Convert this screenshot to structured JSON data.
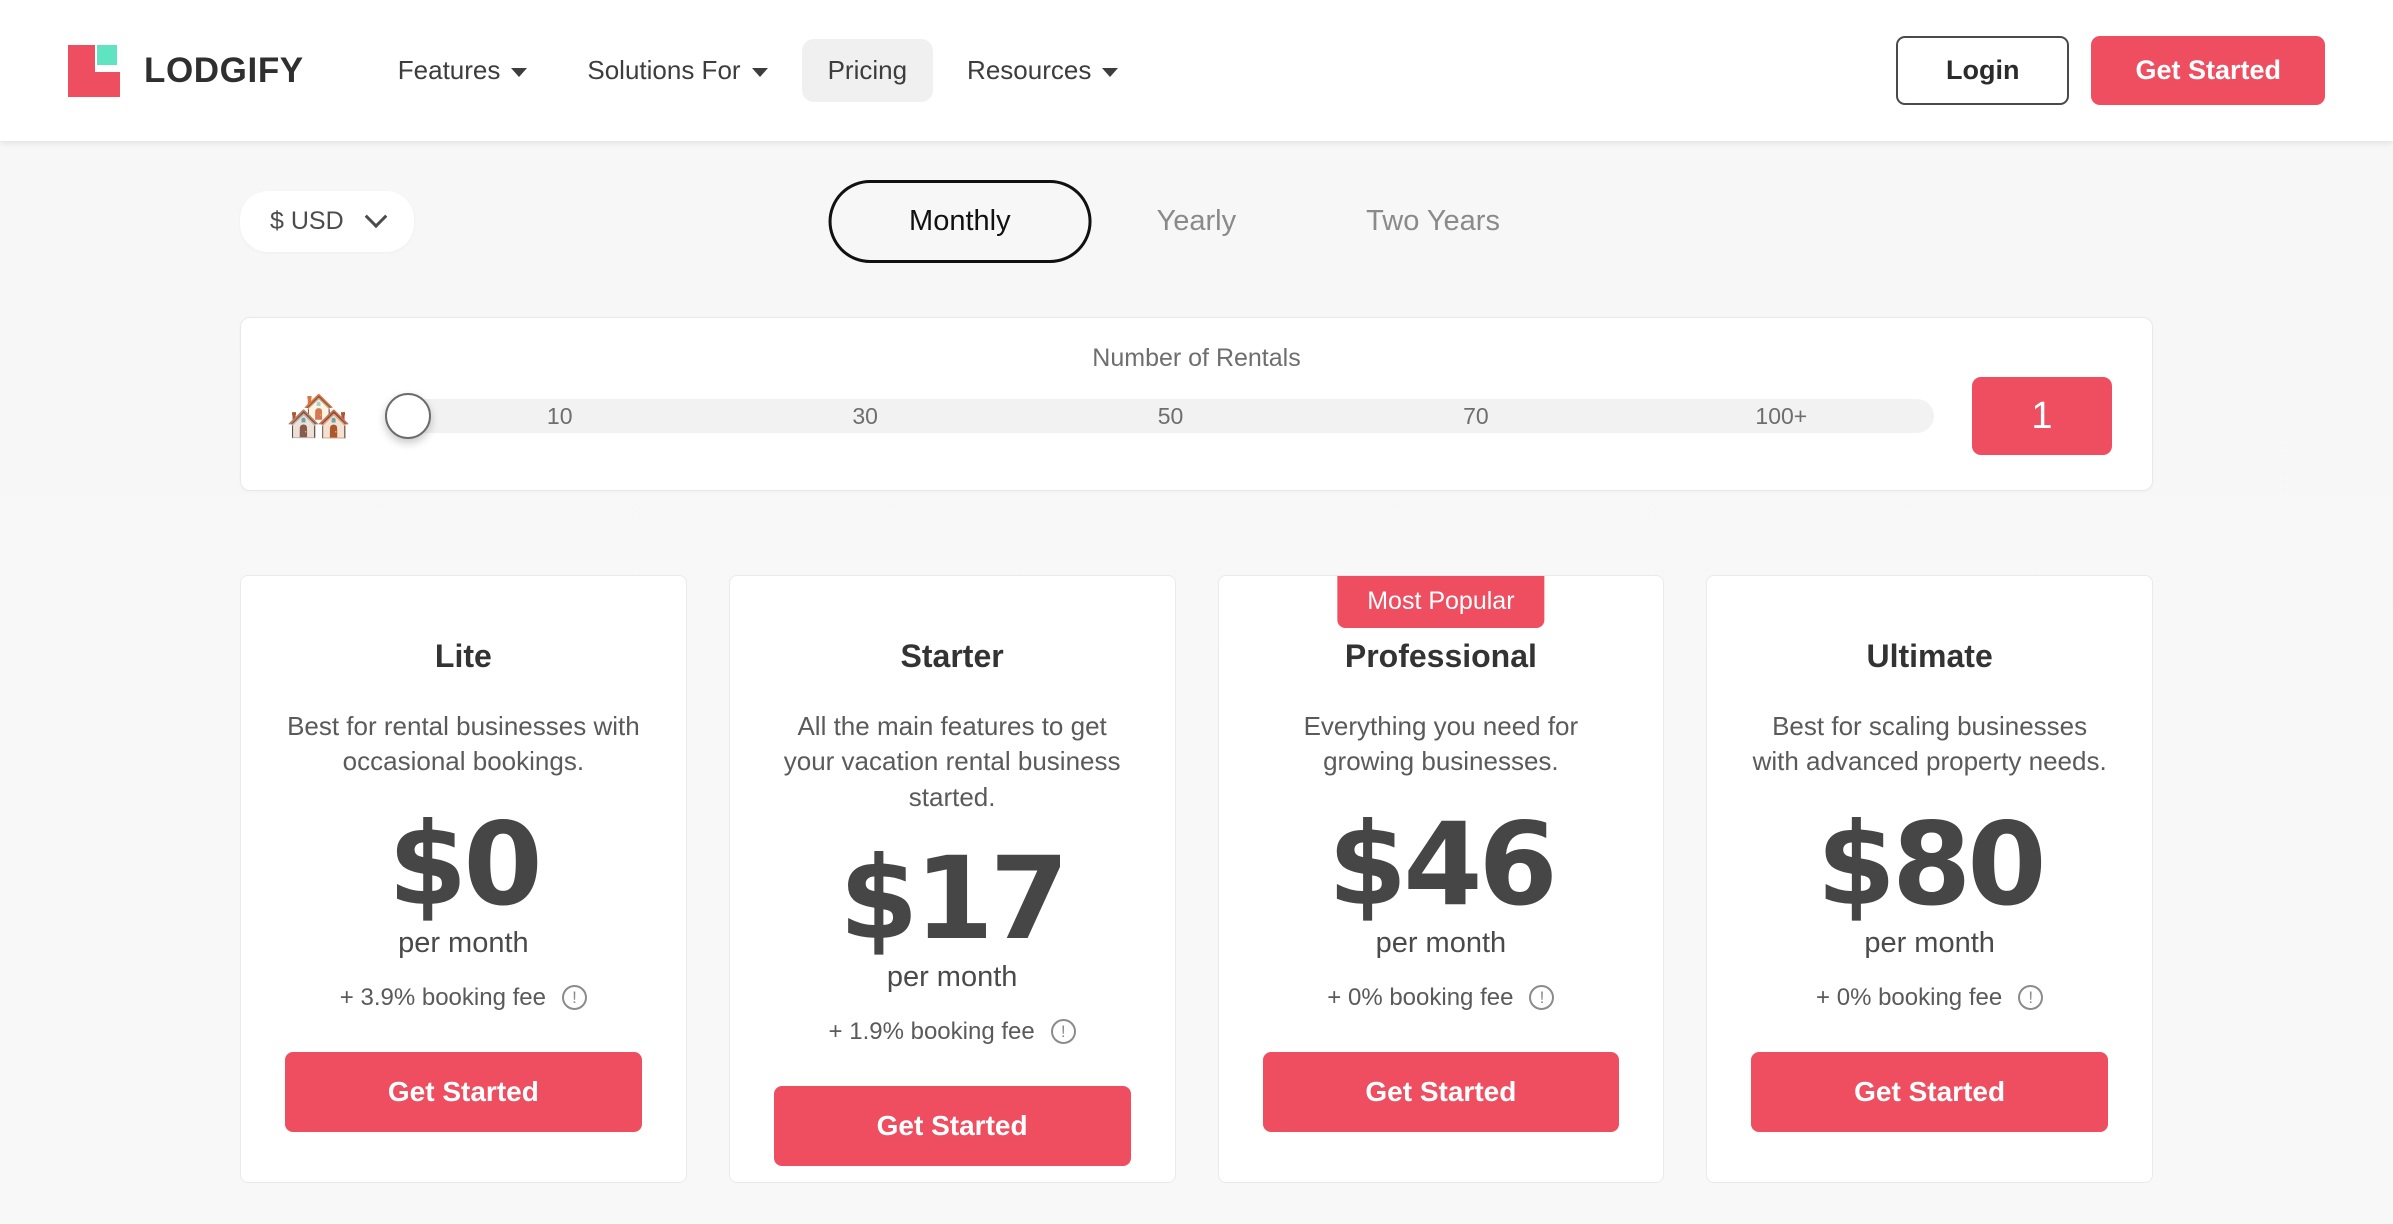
{
  "brand": {
    "name": "LODGIFY",
    "logo_primary_color": "#ee4e5f",
    "logo_accent_color": "#5fe3c0"
  },
  "header": {
    "nav": [
      {
        "label": "Features",
        "has_caret": true,
        "active": false
      },
      {
        "label": "Solutions For",
        "has_caret": true,
        "active": false
      },
      {
        "label": "Pricing",
        "has_caret": false,
        "active": true
      },
      {
        "label": "Resources",
        "has_caret": true,
        "active": false
      }
    ],
    "login_label": "Login",
    "get_started_label": "Get Started"
  },
  "controls": {
    "currency": {
      "value": "$ USD",
      "icon": "chevron-down-icon"
    },
    "billing_options": [
      {
        "label": "Monthly",
        "selected": true
      },
      {
        "label": "Yearly",
        "selected": false
      },
      {
        "label": "Two Years",
        "selected": false
      }
    ]
  },
  "rentals": {
    "label": "Number of Rentals",
    "emoji": "🏘️",
    "emoji_name": "houses-emoji",
    "ticks": [
      "10",
      "30",
      "50",
      "70",
      "100+"
    ],
    "value": "1",
    "handle_position_percent": 0,
    "accent_color": "#ee4e5f"
  },
  "plans": [
    {
      "name": "Lite",
      "description": "Best for rental businesses with occasional bookings.",
      "price": "$0",
      "period": "per month",
      "fee": "+ 3.9% booking fee",
      "cta": "Get Started",
      "badge": null
    },
    {
      "name": "Starter",
      "description": "All the main features to get your vacation rental business started.",
      "price": "$17",
      "period": "per month",
      "fee": "+ 1.9% booking fee",
      "cta": "Get Started",
      "badge": null
    },
    {
      "name": "Professional",
      "description": "Everything you need for growing businesses.",
      "price": "$46",
      "period": "per month",
      "fee": "+ 0% booking fee",
      "cta": "Get Started",
      "badge": "Most Popular"
    },
    {
      "name": "Ultimate",
      "description": "Best for scaling businesses with advanced property needs.",
      "price": "$80",
      "period": "per month",
      "fee": "+ 0% booking fee",
      "cta": "Get Started",
      "badge": null
    }
  ],
  "colors": {
    "accent_red": "#ee4e5f",
    "accent_teal": "#5fe3c0",
    "page_background": "#f7f7f7",
    "card_background": "#ffffff"
  }
}
